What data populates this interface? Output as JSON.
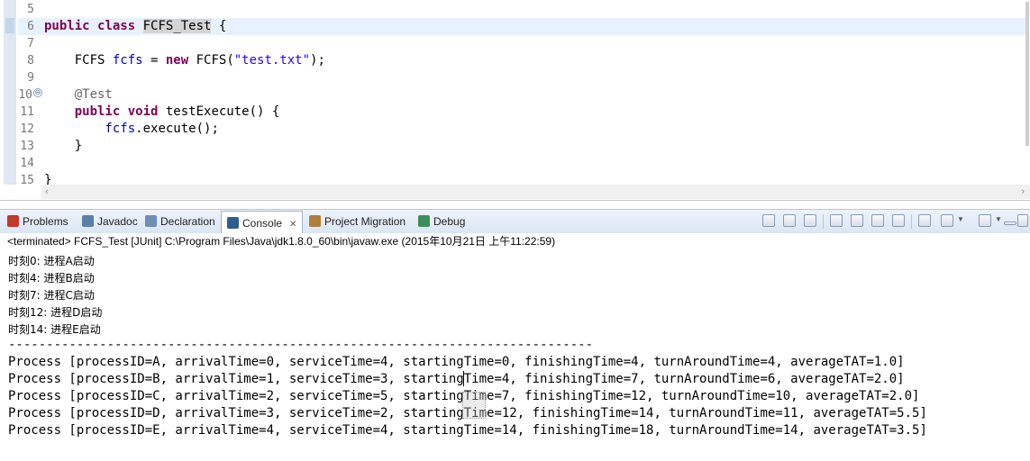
{
  "editor": {
    "line_numbers": [
      "5",
      "6",
      "7",
      "8",
      "9",
      "10",
      "11",
      "12",
      "13",
      "14",
      "15"
    ],
    "fold_marker": "⊖",
    "code": {
      "l6_kw1": "public",
      "l6_kw2": "class",
      "l6_name": "FCFS_Test",
      "l6_brace": " {",
      "l8_type": "    FCFS ",
      "l8_field": "fcfs",
      "l8_eq": " = ",
      "l8_new": "new",
      "l8_call": " FCFS(",
      "l8_str": "\"test.txt\"",
      "l8_end": ");",
      "l10_anno": "    @Test",
      "l11_kw1": "    public",
      "l11_kw2": " void",
      "l11_rest": " testExecute() {",
      "l12_field": "        fcfs",
      "l12_rest": ".execute();",
      "l13": "    }",
      "l15": "}"
    }
  },
  "tabs": [
    {
      "label": "Problems",
      "icon": "problems-icon"
    },
    {
      "label": "Javadoc",
      "icon": "javadoc-icon"
    },
    {
      "label": "Declaration",
      "icon": "declaration-icon"
    },
    {
      "label": "Console",
      "icon": "console-icon",
      "close": "✕"
    },
    {
      "label": "Project Migration",
      "icon": "project-migration-icon"
    },
    {
      "label": "Debug",
      "icon": "debug-icon"
    }
  ],
  "status": "<terminated> FCFS_Test [JUnit] C:\\Program Files\\Java\\jdk1.8.0_60\\bin\\javaw.exe (2015年10月21日 上午11:22:59)",
  "console_lines": [
    "时刻0: 进程A启动",
    "时刻4: 进程B启动",
    "时刻7: 进程C启动",
    "时刻12: 进程D启动",
    "时刻14: 进程E启动",
    "-----------------------------------------------------------------------------",
    "Process [processID=A, arrivalTime=0, serviceTime=4, startingTime=0, finishingTime=4, turnAroundTime=4, averageTAT=1.0]",
    "Process [processID=B, arrivalTime=1, serviceTime=3, startingTime=4, finishingTime=7, turnAroundTime=6, averageTAT=2.0]",
    "Process [processID=C, arrivalTime=2, serviceTime=5, startingTime=7, finishingTime=12, turnAroundTime=10, averageTAT=2.0]",
    "Process [processID=D, arrivalTime=3, serviceTime=2, startingTime=12, finishingTime=14, turnAroundTime=11, averageTAT=5.5]",
    "Process [processID=E, arrivalTime=4, serviceTime=4, startingTime=14, finishingTime=18, turnAroundTime=14, averageTAT=3.5]"
  ],
  "colors": {
    "keyword": "#7f0055",
    "string": "#2a00ff",
    "field": "#0000c0",
    "annotation": "#646464",
    "tabbar_top": "#eef3fa",
    "tabbar_bottom": "#dbe6f4"
  },
  "toolbar_icons": [
    "terminate-icon",
    "remove-launch-icon",
    "remove-all-terminated-icon",
    "scroll-lock-icon",
    "show-on-output-icon",
    "show-on-error-icon",
    "word-wrap-icon",
    "pin-console-icon",
    "display-selected-console-icon",
    "open-console-icon",
    "minimize-icon",
    "maximize-icon"
  ]
}
